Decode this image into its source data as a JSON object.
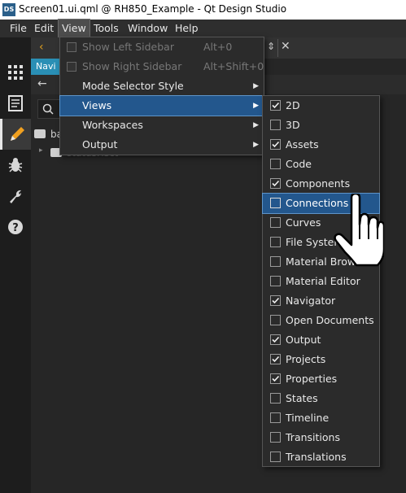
{
  "titlebar": {
    "icon_text": "DS",
    "title": "Screen01.ui.qml @ RH850_Example - Qt Design Studio"
  },
  "menubar": [
    {
      "label": "File"
    },
    {
      "label": "Edit"
    },
    {
      "label": "View"
    },
    {
      "label": "Tools"
    },
    {
      "label": "Window"
    },
    {
      "label": "Help"
    }
  ],
  "modebar": [
    "grid-icon",
    "document-icon",
    "pencil-icon",
    "bug-icon",
    "wrench-icon",
    "help-icon"
  ],
  "content": {
    "nav_tab": "Navi",
    "tree": [
      {
        "label": "ba"
      },
      {
        "label": "statusRect"
      }
    ]
  },
  "view_menu": [
    {
      "label": "Show Left Sidebar",
      "shortcut": "Alt+0",
      "disabled": true
    },
    {
      "label": "Show Right Sidebar",
      "shortcut": "Alt+Shift+0",
      "disabled": true
    },
    {
      "label": "Mode Selector Style",
      "submenu": true
    },
    {
      "label": "Views",
      "submenu": true,
      "highlight": true
    },
    {
      "label": "Workspaces",
      "submenu": true
    },
    {
      "label": "Output",
      "submenu": true
    }
  ],
  "views_menu": [
    {
      "label": "2D",
      "checked": true
    },
    {
      "label": "3D",
      "checked": false
    },
    {
      "label": "Assets",
      "checked": true
    },
    {
      "label": "Code",
      "checked": false
    },
    {
      "label": "Components",
      "checked": true
    },
    {
      "label": "Connections",
      "checked": false,
      "highlight": true
    },
    {
      "label": "Curves",
      "checked": false
    },
    {
      "label": "File System",
      "checked": false
    },
    {
      "label": "Material Brows",
      "checked": false
    },
    {
      "label": "Material Editor",
      "checked": false
    },
    {
      "label": "Navigator",
      "checked": true
    },
    {
      "label": "Open Documents",
      "checked": false
    },
    {
      "label": "Output",
      "checked": true
    },
    {
      "label": "Projects",
      "checked": true
    },
    {
      "label": "Properties",
      "checked": true
    },
    {
      "label": "States",
      "checked": false
    },
    {
      "label": "Timeline",
      "checked": false
    },
    {
      "label": "Transitions",
      "checked": false
    },
    {
      "label": "Translations",
      "checked": false
    }
  ],
  "colors": {
    "highlight": "#23578d",
    "nav_tab": "#2a8fb5",
    "menu_bg": "#2b2b2b"
  }
}
